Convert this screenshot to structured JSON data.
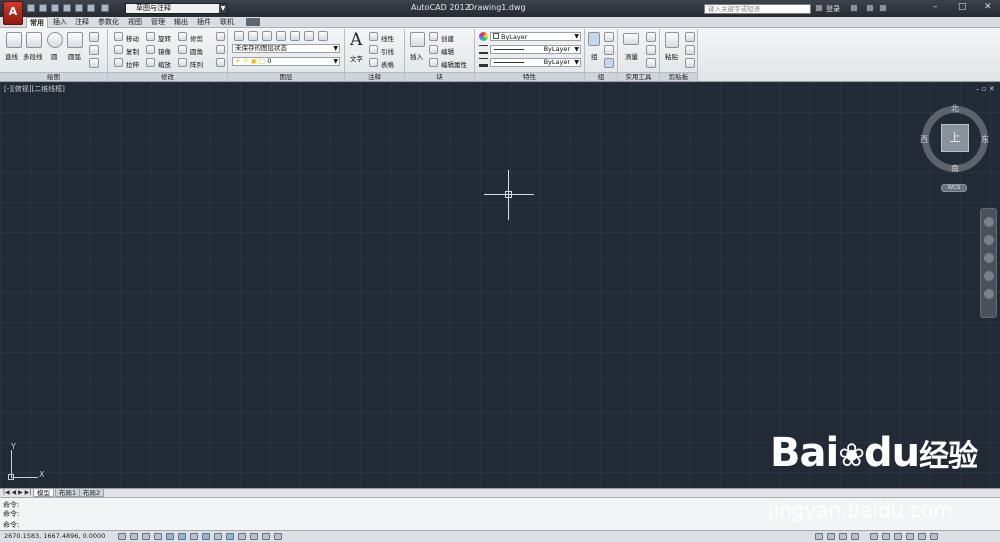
{
  "app": {
    "name": "AutoCAD 2012",
    "file": "Drawing1.dwg"
  },
  "workspace": "草图与注释",
  "search_placeholder": "键入关键字或短语",
  "login": "登录",
  "tabs": [
    "常用",
    "插入",
    "注释",
    "参数化",
    "视图",
    "管理",
    "输出",
    "插件",
    "联机"
  ],
  "active_tab": "常用",
  "panels": {
    "draw": {
      "title": "绘图",
      "items": [
        "直线",
        "多段线",
        "圆",
        "圆弧"
      ]
    },
    "modify": {
      "title": "修改",
      "items": [
        "移动",
        "旋转",
        "修剪",
        "复制",
        "镜像",
        "圆角",
        "拉伸",
        "缩放",
        "阵列"
      ]
    },
    "layers": {
      "title": "图层",
      "layer_state": "未保存的图层状态",
      "current_layer": "0"
    },
    "annotation": {
      "title": "注释",
      "text_label": "文字",
      "items": [
        "线性",
        "引线",
        "表格"
      ]
    },
    "block": {
      "title": "块",
      "insert": "插入",
      "items": [
        "创建",
        "编辑",
        "编辑属性"
      ]
    },
    "properties": {
      "title": "特性",
      "color": "ByLayer",
      "linetype": "ByLayer",
      "lineweight": "ByLayer"
    },
    "groups": {
      "title": "组",
      "group": "组"
    },
    "utilities": {
      "title": "实用工具",
      "measure": "测量"
    },
    "clipboard": {
      "title": "剪贴板",
      "paste": "粘贴"
    }
  },
  "viewport_label": "[-][俯视][二维线框]",
  "viewcube": {
    "face": "上",
    "north": "北",
    "south": "南",
    "east": "东",
    "west": "西",
    "wcs": "WCS"
  },
  "ucs": {
    "x": "X",
    "y": "Y"
  },
  "layout_tabs": [
    "模型",
    "布局1",
    "布局2"
  ],
  "active_layout": "模型",
  "command_lines": [
    "命令:",
    "命令:",
    "命令:"
  ],
  "coordinates": "2670.1583, 1667.4896, 0.0000",
  "colors": {
    "canvas": "#222a35",
    "grid": "#2f3946",
    "logo": "#c0352a"
  },
  "watermark": {
    "brand": "Bai",
    "brand2": "du",
    "cn": "经验",
    "url": "jingyan.baidu.com"
  }
}
